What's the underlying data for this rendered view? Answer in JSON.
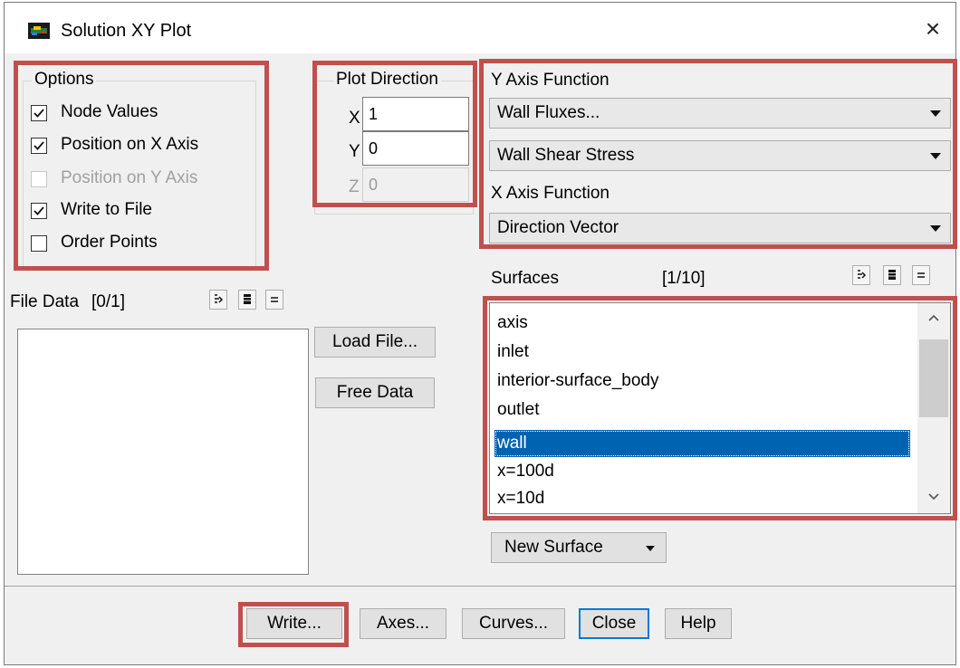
{
  "window": {
    "title": "Solution XY Plot",
    "close_glyph": "×"
  },
  "options": {
    "title": "Options",
    "items": [
      {
        "label": "Node Values",
        "checked": true,
        "enabled": true
      },
      {
        "label": "Position on X Axis",
        "checked": true,
        "enabled": true
      },
      {
        "label": "Position on Y Axis",
        "checked": false,
        "enabled": false
      },
      {
        "label": "Write to File",
        "checked": true,
        "enabled": true
      },
      {
        "label": "Order Points",
        "checked": false,
        "enabled": true
      }
    ]
  },
  "plot_direction": {
    "title": "Plot Direction",
    "x_label": "X",
    "x_value": "1",
    "y_label": "Y",
    "y_value": "0",
    "z_label": "Z",
    "z_value": "0"
  },
  "y_axis": {
    "title": "Y Axis Function",
    "category": "Wall Fluxes...",
    "function": "Wall Shear Stress"
  },
  "x_axis": {
    "title": "X Axis Function",
    "function": "Direction Vector"
  },
  "surfaces": {
    "title": "Surfaces",
    "count": "[1/10]",
    "items": [
      "axis",
      "inlet",
      "interior-surface_body",
      "outlet",
      "wall",
      "x=100d",
      "x=10d"
    ],
    "selected": "wall",
    "new_surface_label": "New Surface"
  },
  "file_data": {
    "title": "File Data",
    "count": "[0/1]"
  },
  "buttons": {
    "load_file": "Load File...",
    "free_data": "Free Data",
    "write": "Write...",
    "axes": "Axes...",
    "curves": "Curves...",
    "close": "Close",
    "help": "Help"
  },
  "colors": {
    "highlight_border": "#c0504d",
    "selection": "#0063b1",
    "default_button_border": "#0078d7"
  },
  "icons": [
    "fluent-app-icon",
    "close-icon",
    "checkbox-check-icon",
    "select-all-icon",
    "deselect-all-icon",
    "select-none-icon",
    "dropdown-arrow-icon",
    "scroll-up-icon",
    "scroll-down-icon"
  ]
}
